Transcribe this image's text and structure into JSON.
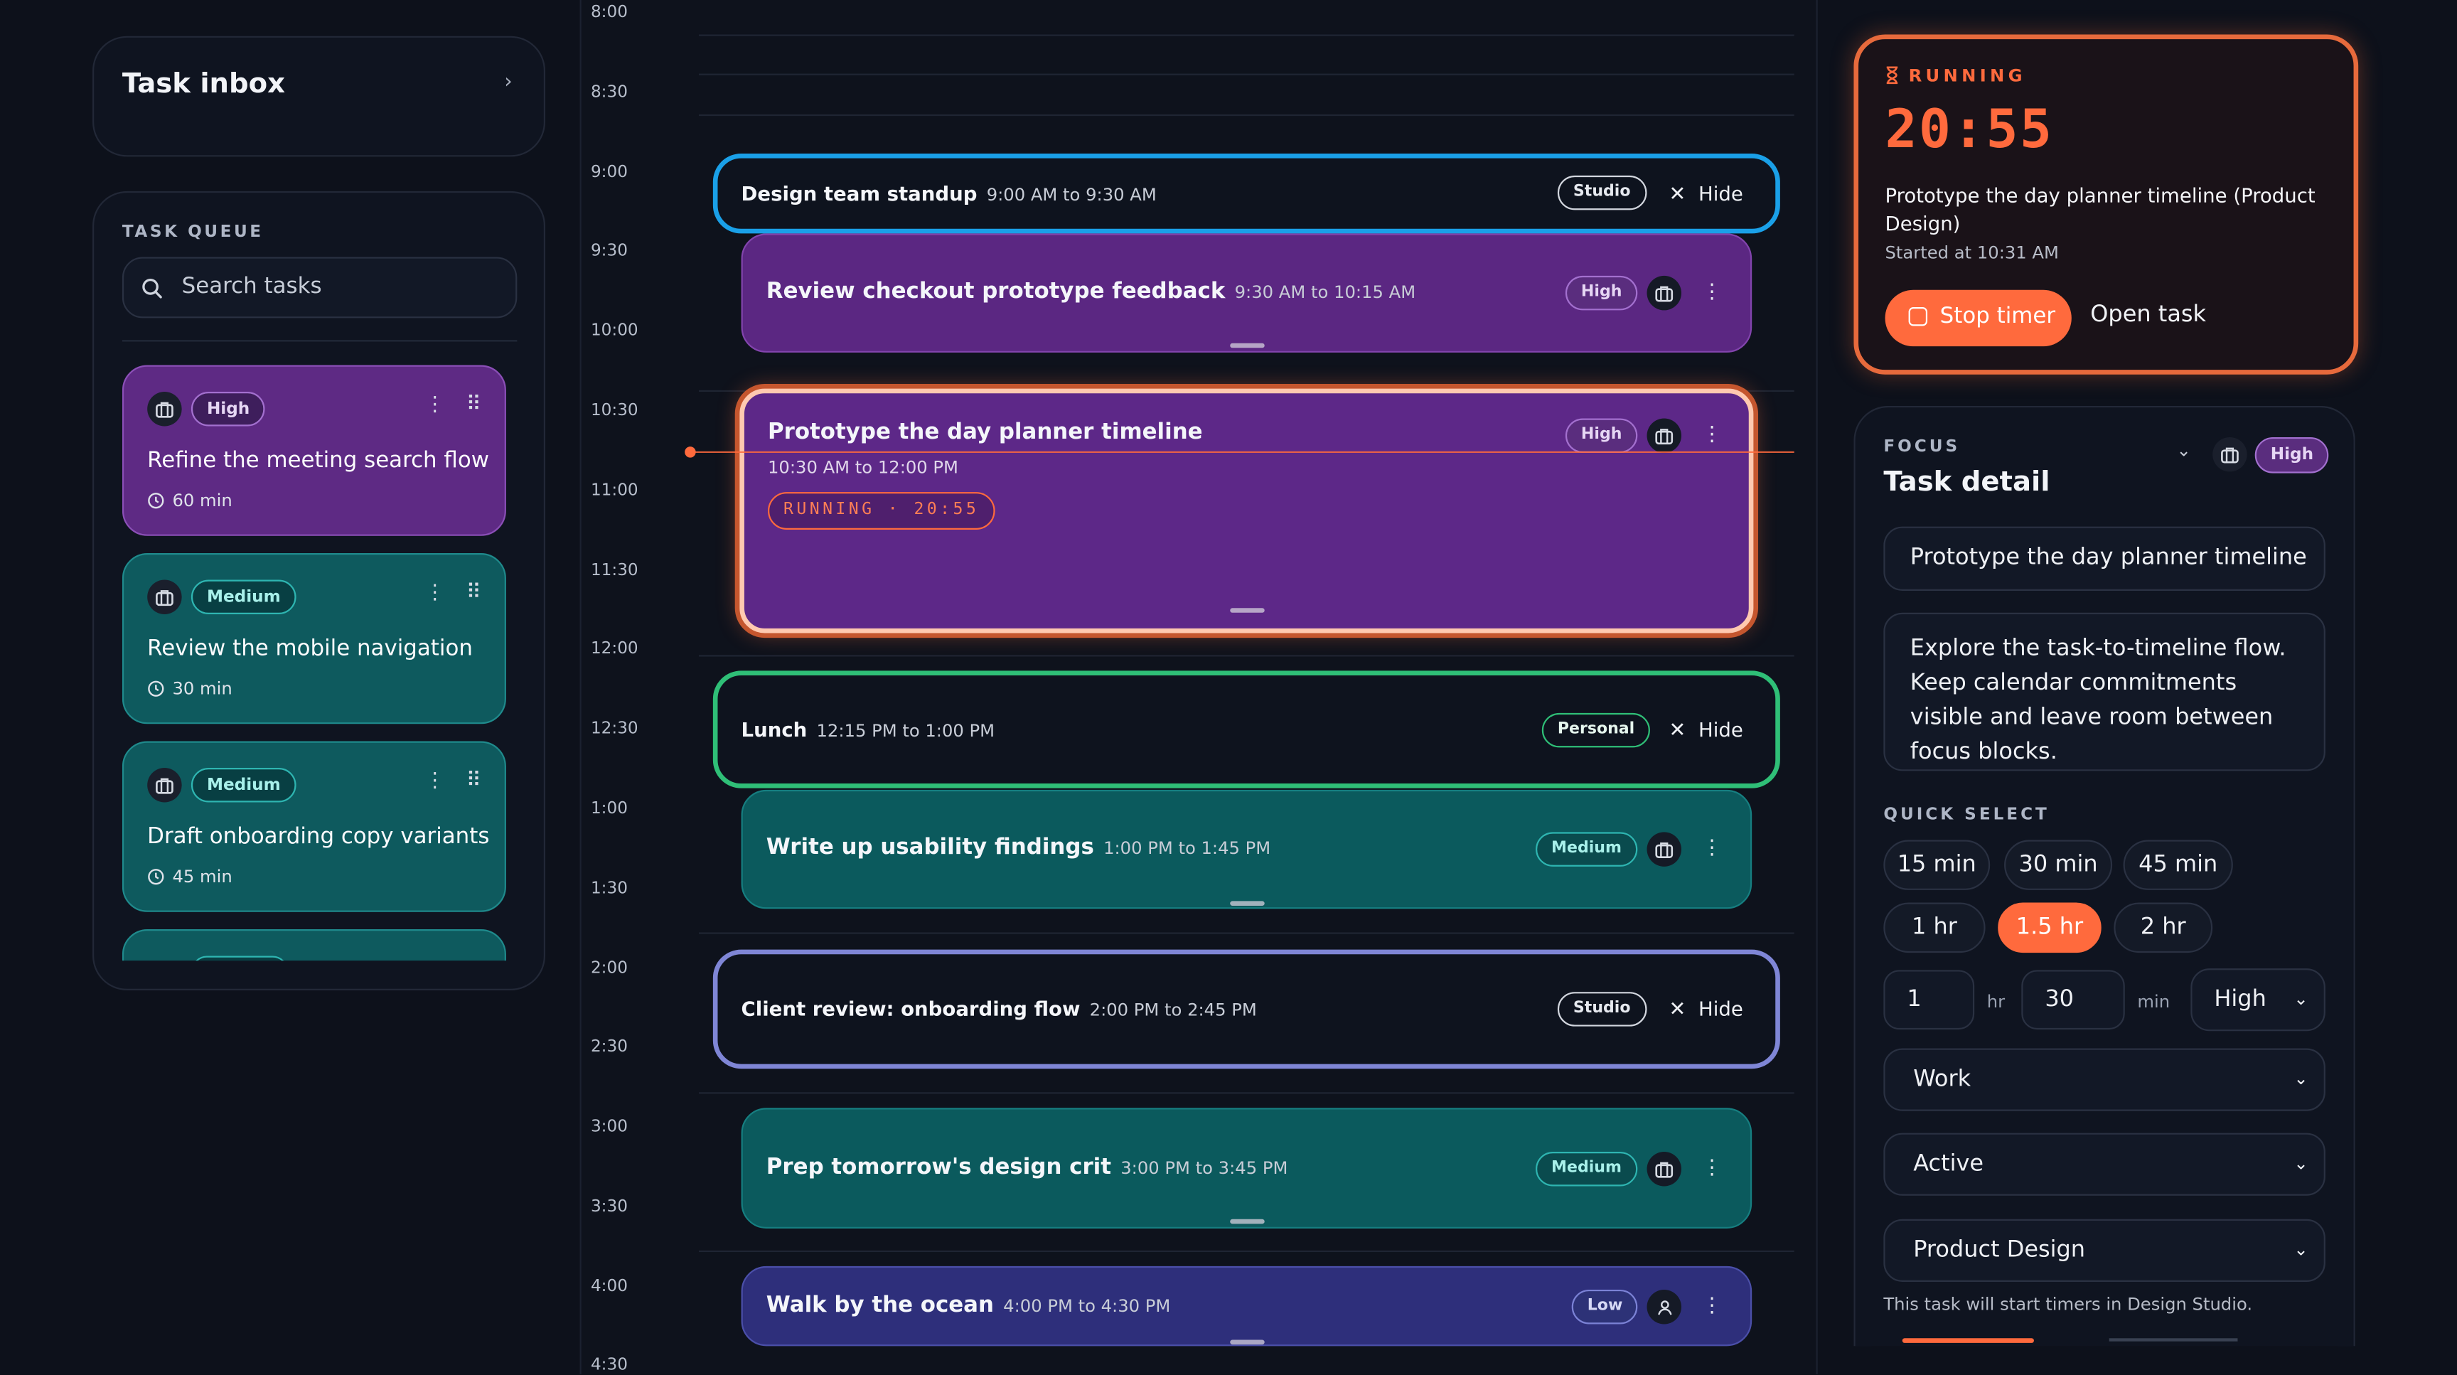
{
  "inbox": {
    "title": "Task inbox"
  },
  "queue": {
    "heading": "TASK QUEUE",
    "search_placeholder": "Search tasks",
    "items": [
      {
        "priority": "High",
        "title": "Refine the meeting search flow",
        "duration": "60 min",
        "color": "#5e2a84"
      },
      {
        "priority": "Medium",
        "title": "Review the mobile navigation",
        "duration": "30 min",
        "color": "#0e5a5e"
      },
      {
        "priority": "Medium",
        "title": "Draft onboarding copy variants",
        "duration": "45 min",
        "color": "#0e5a5e"
      }
    ]
  },
  "timeline": {
    "hours": [
      "8:00",
      "8:30",
      "9:00",
      "9:30",
      "10:00",
      "10:30",
      "11:00",
      "11:30",
      "12:00",
      "12:30",
      "1:00",
      "1:30",
      "2:00",
      "2:30",
      "3:00",
      "3:30",
      "4:00",
      "4:30"
    ],
    "hide_label": "Hide",
    "events": [
      {
        "title": "Design team standup",
        "time": "9:00 AM to 9:30 AM",
        "tag": "Studio"
      },
      {
        "title": "Lunch",
        "time": "12:15 PM to 1:00 PM",
        "tag": "Personal"
      },
      {
        "title": "Client review: onboarding flow",
        "time": "2:00 PM to 2:45 PM",
        "tag": "Studio"
      }
    ],
    "tasks": [
      {
        "title": "Review checkout prototype feedback",
        "time": "9:30 AM to 10:15 AM",
        "priority": "High"
      },
      {
        "title": "Prototype the day planner timeline",
        "time": "10:30 AM to 12:00 PM",
        "priority": "High",
        "status": "RUNNING · 20:55"
      },
      {
        "title": "Write up usability findings",
        "time": "1:00 PM to 1:45 PM",
        "priority": "Medium"
      },
      {
        "title": "Prep tomorrow's design crit",
        "time": "3:00 PM to 3:45 PM",
        "priority": "Medium"
      },
      {
        "title": "Walk by the ocean",
        "time": "4:00 PM to 4:30 PM",
        "priority": "Low"
      }
    ]
  },
  "timer": {
    "status": "RUNNING",
    "elapsed": "20:55",
    "task": "Prototype the day planner timeline (Product Design)",
    "started": "Started at 10:31 AM",
    "stop_label": "Stop timer",
    "open_label": "Open task",
    "accent": "#ff6a3d"
  },
  "detail": {
    "focus_label": "FOCUS",
    "title": "Task detail",
    "priority_badge": "High",
    "name_value": "Prototype the day planner timeline",
    "description": "Explore the task-to-timeline flow. Keep calendar commitments visible and leave room between focus blocks.",
    "quick_select_label": "QUICK SELECT",
    "quick_select": [
      "15 min",
      "30 min",
      "45 min",
      "1 hr",
      "1.5 hr",
      "2 hr"
    ],
    "selected_quick": "1.5 hr",
    "hours_value": "1",
    "hours_unit": "hr",
    "minutes_value": "30",
    "minutes_unit": "min",
    "priority_select": "High",
    "category_select": "Work",
    "status_select": "Active",
    "project_select": "Product Design",
    "hint": "This task will start timers in Design Studio."
  }
}
